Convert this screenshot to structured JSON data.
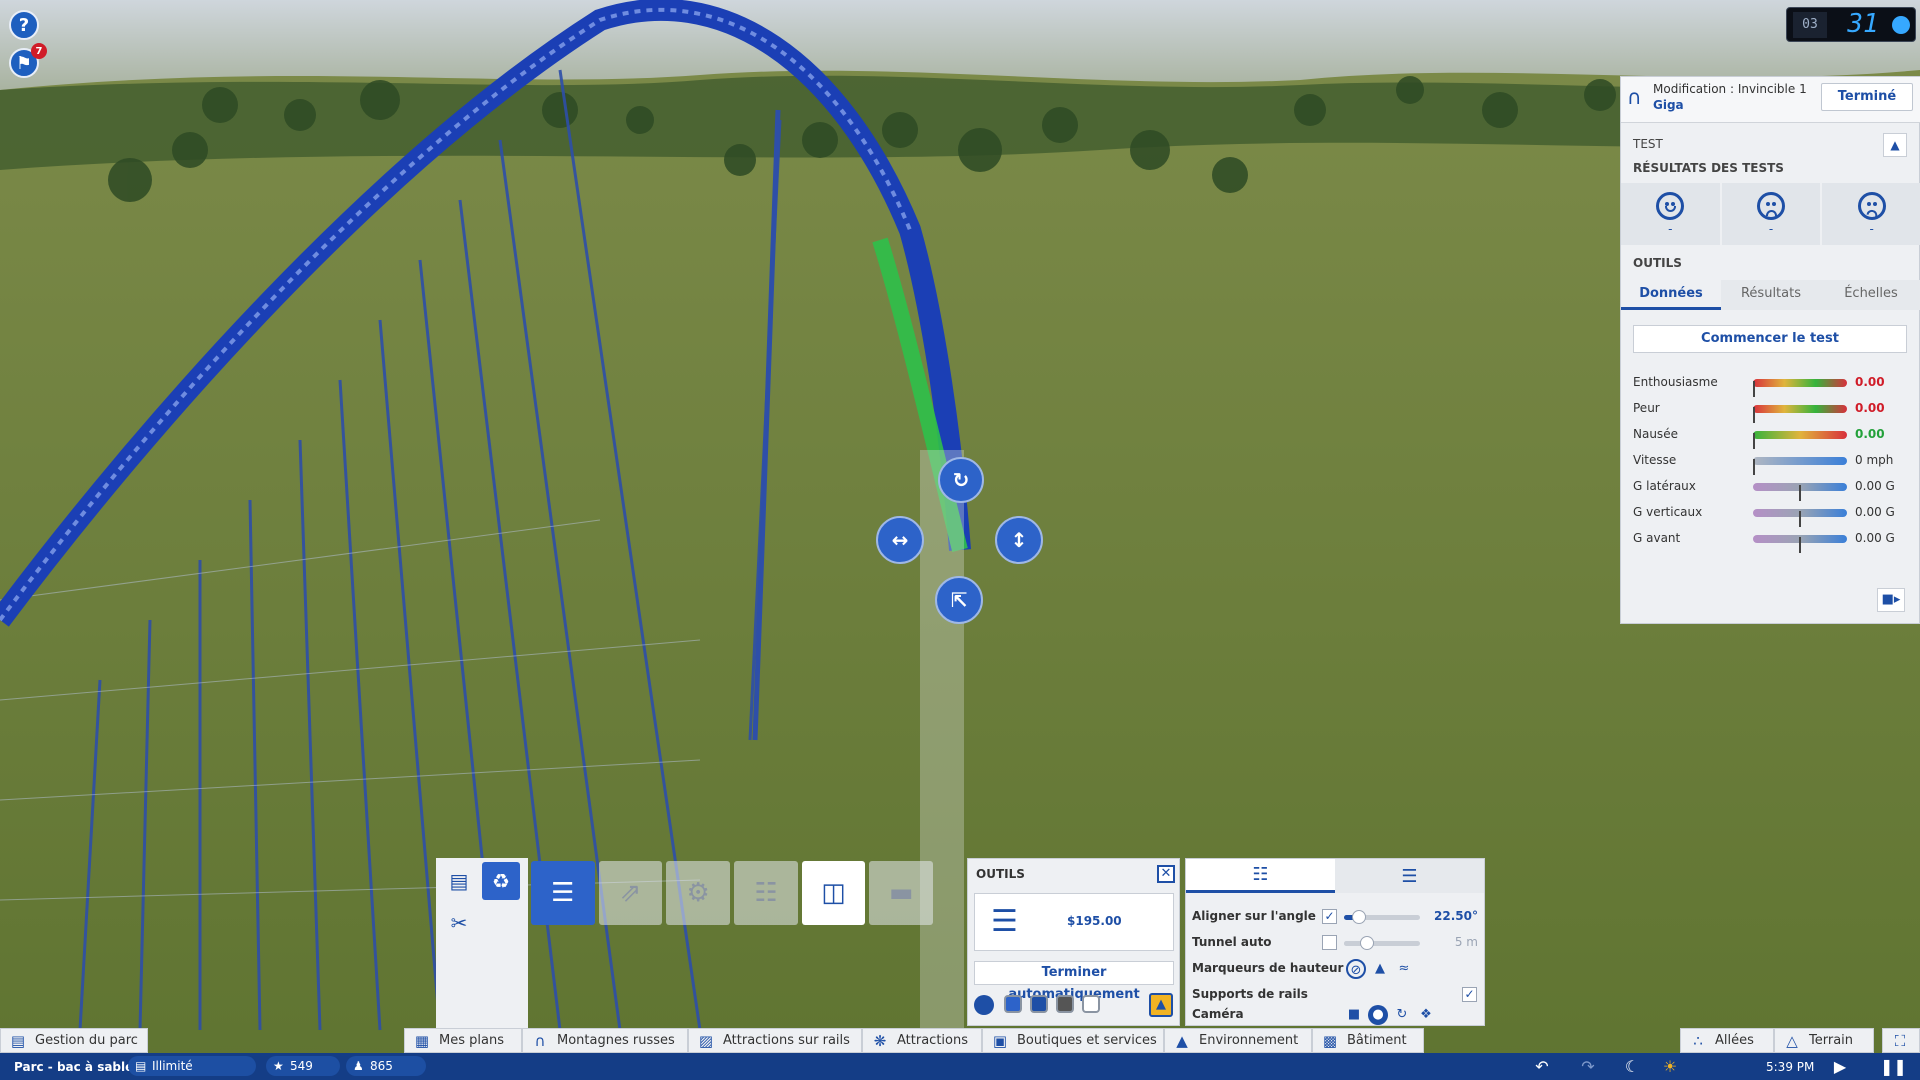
{
  "notifications": {
    "count": "7"
  },
  "clock": {
    "month": "03",
    "day": "31"
  },
  "ride_panel": {
    "title": "Modification : Invincible 1",
    "subtitle": "Giga",
    "done_label": "Terminé",
    "test_label": "TEST",
    "results_label": "RÉSULTATS DES TESTS",
    "faces": [
      {
        "icon": "happy-face-icon",
        "value": "-"
      },
      {
        "icon": "sad-face-icon",
        "value": "-"
      },
      {
        "icon": "sick-face-icon",
        "value": "-"
      }
    ],
    "tools_label": "OUTILS",
    "tabs": [
      "Données",
      "Résultats",
      "Échelles"
    ],
    "start_test_label": "Commencer le test",
    "stats": [
      {
        "label": "Enthousiasme",
        "value": "0.00",
        "level": 0
      },
      {
        "label": "Peur",
        "value": "0.00",
        "level": 0
      },
      {
        "label": "Nausée",
        "value": "0.00",
        "level": 0
      },
      {
        "label": "Vitesse",
        "value": "0 mph",
        "level": 0
      },
      {
        "label": "G latéraux",
        "value": "0.00 G",
        "level": 0.5
      },
      {
        "label": "G verticaux",
        "value": "0.00 G",
        "level": 0.5
      },
      {
        "label": "G avant",
        "value": "0.00 G",
        "level": 0.5
      }
    ],
    "colors": {
      "accent": "#1e4fa6",
      "negative": "#d01c28",
      "positive": "#23a13a"
    }
  },
  "outils": {
    "title": "OUTILS",
    "cost": "$195.00",
    "auto_finish_label": "Terminer automatiquement",
    "swatches": [
      "#2d63c9",
      "#1e4fa6",
      "#555555",
      "#ffffff"
    ]
  },
  "options": {
    "rows": [
      {
        "label": "Aligner sur l'angle",
        "checked": true,
        "value": "22.50°",
        "level": 0.2
      },
      {
        "label": "Tunnel auto",
        "checked": false,
        "value": "5 m",
        "level": 0.3
      },
      {
        "label": "Marqueurs de hauteur"
      },
      {
        "label": "Supports de rails",
        "checked": true
      },
      {
        "label": "Caméra"
      }
    ]
  },
  "nav": {
    "park_management": "Gestion du parc",
    "my_plans": "Mes plans",
    "coasters": "Montagnes russes",
    "track_rides": "Attractions sur rails",
    "attractions": "Attractions",
    "shops": "Boutiques et services",
    "environment": "Environnement",
    "building": "Bâtiment",
    "paths": "Allées",
    "terrain": "Terrain"
  },
  "status": {
    "park_name": "Parc - bac à sable",
    "money": "Illimité",
    "rating": "549",
    "guests": "865",
    "time": "5:39 PM"
  }
}
